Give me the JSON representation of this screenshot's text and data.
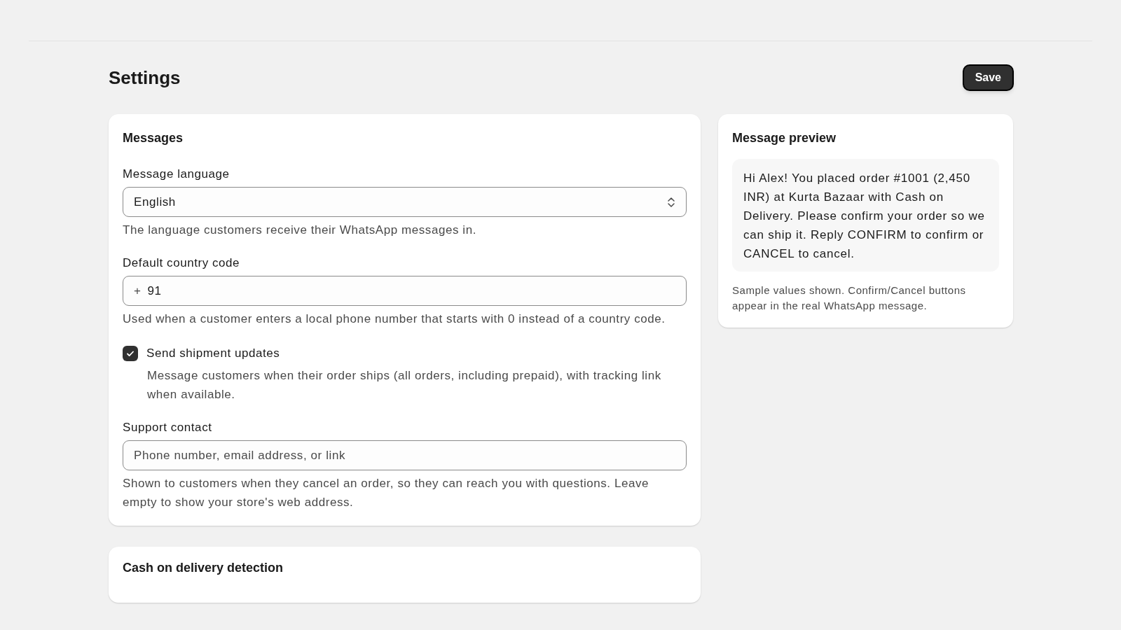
{
  "header": {
    "title": "Settings",
    "save_button": "Save"
  },
  "messages_card": {
    "title": "Messages",
    "fields": [
      {
        "kind": "select",
        "label": "Message language",
        "value": "English",
        "help": "The language customers receive their WhatsApp messages in."
      },
      {
        "kind": "prefixed",
        "label": "Default country code",
        "prefix": "+",
        "value": "91",
        "help": "Used when a customer enters a local phone number that starts with 0 instead of a country code."
      },
      {
        "kind": "checkbox",
        "label": "Send shipment updates",
        "checked": true,
        "help": "Message customers when their order ships (all orders, including prepaid), with tracking link when available."
      },
      {
        "kind": "text",
        "label": "Support contact",
        "placeholder": "Phone number, email address, or link",
        "help": "Shown to customers when they cancel an order, so they can reach you with questions. Leave empty to show your store's web address."
      }
    ]
  },
  "preview_card": {
    "title": "Message preview",
    "message": "Hi Alex! You placed order #1001 (2,450 INR) at Kurta Bazaar with Cash on Delivery. Please confirm your order so we can ship it. Reply CONFIRM to confirm or CANCEL to cancel.",
    "note": "Sample values shown. Confirm/Cancel buttons appear in the real WhatsApp message."
  },
  "cod_card": {
    "title": "Cash on delivery detection"
  }
}
